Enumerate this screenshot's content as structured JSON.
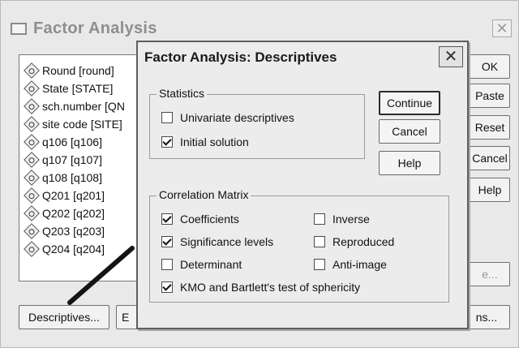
{
  "background_window": {
    "title": "Factor Analysis",
    "close_glyph": "✕",
    "variables": [
      "Round [round]",
      "State [STATE]",
      "sch.number [QN",
      "site code [SITE]",
      "q106 [q106]",
      "q107 [q107]",
      "q108 [q108]",
      "Q201 [q201]",
      "Q202 [q202]",
      "Q203 [q203]",
      "Q204 [q204]"
    ],
    "buttons": {
      "ok": "OK",
      "paste": "Paste",
      "reset": "Reset",
      "cancel": "Cancel",
      "help": "Help",
      "descriptives": "Descriptives...",
      "extraction_partial": "E",
      "options_partial": "ns...",
      "value_partial": "e..."
    }
  },
  "dialog": {
    "title": "Factor Analysis: Descriptives",
    "close_glyph": "✕",
    "statistics": {
      "label": "Statistics",
      "items": [
        {
          "label": "Univariate descriptives",
          "checked": false
        },
        {
          "label": "Initial solution",
          "checked": true
        }
      ]
    },
    "correlation_matrix": {
      "label": "Correlation Matrix",
      "left_items": [
        {
          "label": "Coefficients",
          "checked": true
        },
        {
          "label": "Significance levels",
          "checked": true
        },
        {
          "label": "Determinant",
          "checked": false
        }
      ],
      "right_items": [
        {
          "label": "Inverse",
          "checked": false
        },
        {
          "label": "Reproduced",
          "checked": false
        },
        {
          "label": "Anti-image",
          "checked": false
        }
      ],
      "kmo": {
        "label": "KMO and Bartlett's test of sphericity",
        "checked": true
      }
    },
    "buttons": {
      "continue": "Continue",
      "cancel": "Cancel",
      "help": "Help"
    }
  }
}
